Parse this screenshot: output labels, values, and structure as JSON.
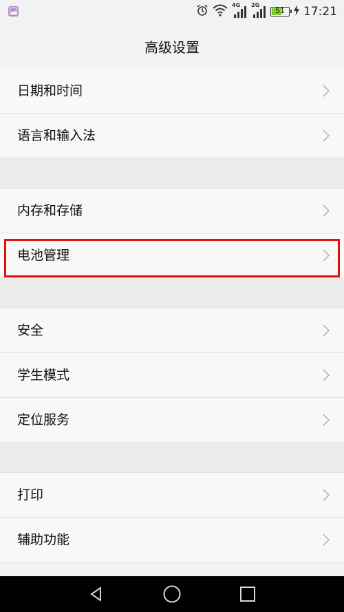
{
  "status_bar": {
    "time": "17:21",
    "battery_level": "51",
    "network_1": "4G",
    "network_2": "2G",
    "icons": [
      "gallery-icon",
      "alarm-icon",
      "wifi-icon",
      "signal-icon",
      "signal-icon",
      "battery-icon",
      "charging-icon"
    ]
  },
  "header": {
    "title": "高级设置"
  },
  "groups": [
    {
      "items": [
        {
          "label": "日期和时间"
        },
        {
          "label": "语言和输入法"
        }
      ]
    },
    {
      "items": [
        {
          "label": "内存和存储"
        },
        {
          "label": "电池管理"
        }
      ]
    },
    {
      "items": [
        {
          "label": "安全"
        },
        {
          "label": "学生模式"
        },
        {
          "label": "定位服务"
        }
      ]
    },
    {
      "items": [
        {
          "label": "打印"
        },
        {
          "label": "辅助功能"
        }
      ]
    }
  ],
  "highlight_color": "#e21111",
  "navigation": {
    "icons": [
      "back-icon",
      "home-icon",
      "recents-icon"
    ]
  }
}
